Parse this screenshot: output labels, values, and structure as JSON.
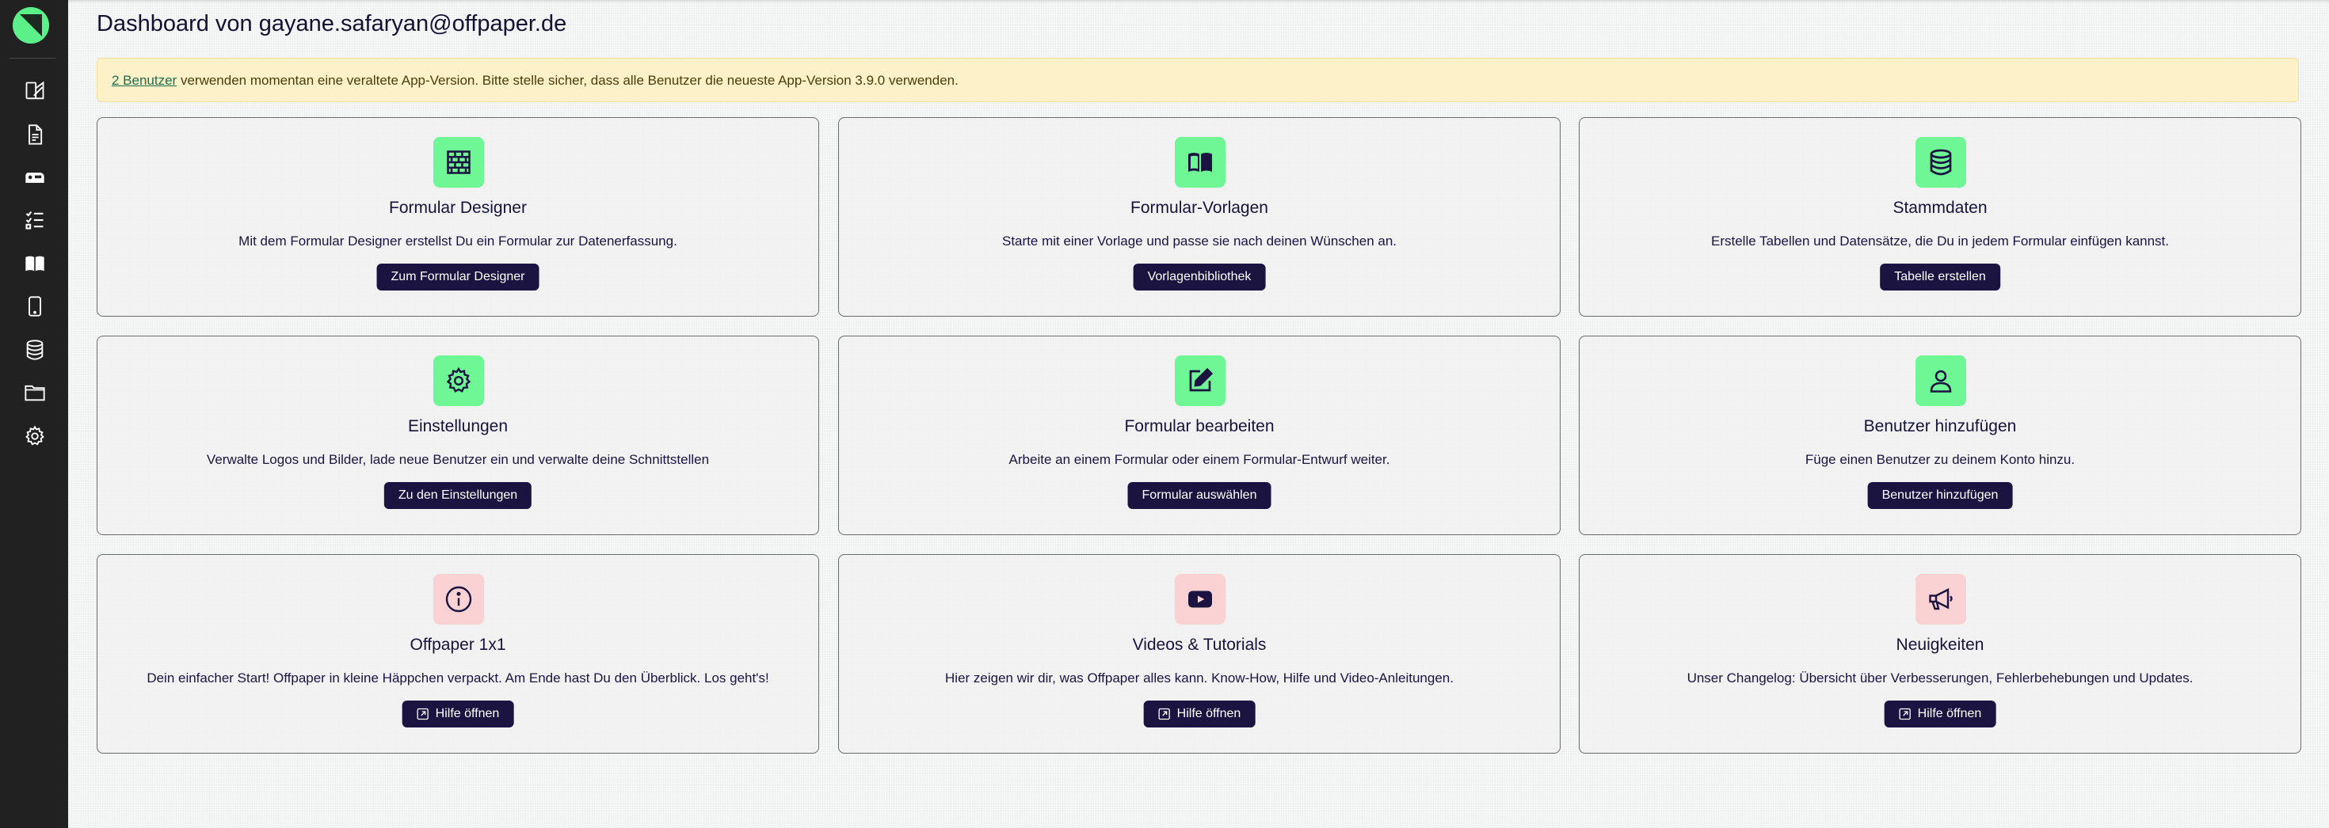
{
  "page": {
    "title": "Dashboard von gayane.safaryan@offpaper.de"
  },
  "alert": {
    "link_text": "2 Benutzer",
    "message": " verwenden momentan eine veraltete App-Version. Bitte stelle sicher, dass alle Benutzer die neueste App-Version 3.9.0 verwenden."
  },
  "sidebar": {
    "icons": [
      "form-designer-icon",
      "document-icon",
      "mailbox-icon",
      "checklist-icon",
      "book-icon",
      "mobile-icon",
      "database-icon",
      "folder-icon",
      "gear-icon"
    ]
  },
  "cards": [
    {
      "icon": "brick-wall-icon",
      "title": "Formular Designer",
      "description": "Mit dem Formular Designer erstellst Du ein Formular zur Datenerfassung.",
      "button": "Zum Formular Designer"
    },
    {
      "icon": "book-open-icon",
      "title": "Formular-Vorlagen",
      "description": "Starte mit einer Vorlage und passe sie nach deinen Wünschen an.",
      "button": "Vorlagenbibliothek"
    },
    {
      "icon": "database-icon",
      "title": "Stammdaten",
      "description": "Erstelle Tabellen und Datensätze, die Du in jedem Formular einfügen kannst.",
      "button": "Tabelle erstellen"
    },
    {
      "icon": "gear-icon",
      "title": "Einstellungen",
      "description": "Verwalte Logos und Bilder, lade neue Benutzer ein und verwalte deine Schnittstellen",
      "button": "Zu den Einstellungen"
    },
    {
      "icon": "edit-icon",
      "title": "Formular bearbeiten",
      "description": "Arbeite an einem Formular oder einem Formular-Entwurf weiter.",
      "button": "Formular auswählen"
    },
    {
      "icon": "person-icon",
      "title": "Benutzer hinzufügen",
      "description": "Füge einen Benutzer zu deinem Konto hinzu.",
      "button": "Benutzer hinzufügen"
    },
    {
      "icon": "info-icon",
      "title": "Offpaper 1x1",
      "description": "Dein einfacher Start! Offpaper in kleine Häppchen verpackt. Am Ende hast Du den Überblick. Los geht's!",
      "button": "Hilfe öffnen"
    },
    {
      "icon": "youtube-icon",
      "title": "Videos & Tutorials",
      "description": "Hier zeigen wir dir, was Offpaper alles kann. Know-How, Hilfe und Video-Anleitungen.",
      "button": "Hilfe öffnen"
    },
    {
      "icon": "megaphone-icon",
      "title": "Neuigkeiten",
      "description": "Unser Changelog: Übersicht über Verbesserungen, Fehlerbehebungen und Updates.",
      "button": "Hilfe öffnen"
    }
  ],
  "colors": {
    "sidebar": "#212121",
    "accent_green": "#6ff796",
    "accent_pink": "#fbd2d4",
    "button": "#1b1440",
    "alert_bg": "#fdf2c7"
  }
}
